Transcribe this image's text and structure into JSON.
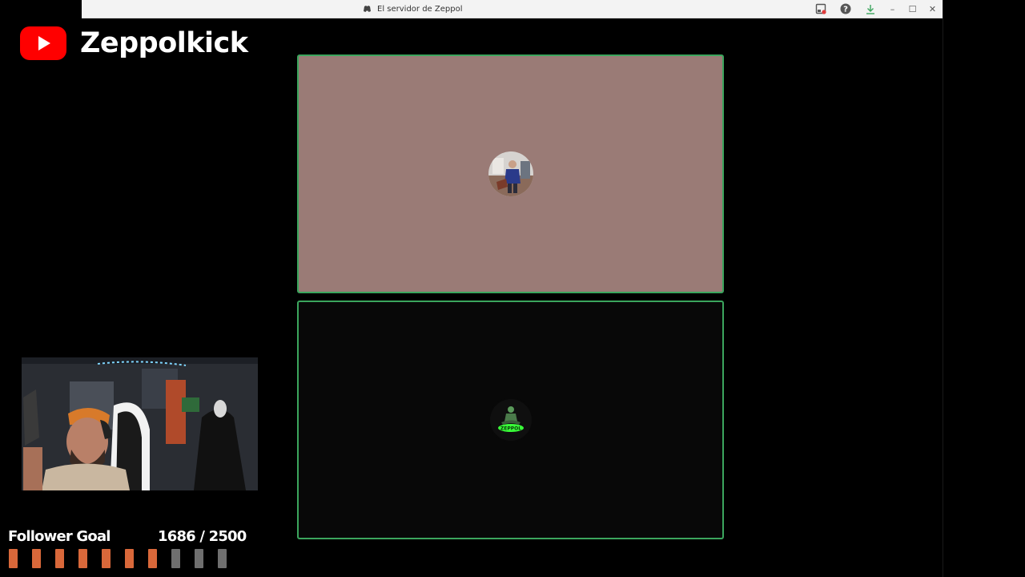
{
  "window": {
    "title": "El servidor de Zeppol",
    "icons": [
      "screen-record-icon",
      "help-icon",
      "download-icon"
    ],
    "controls": {
      "minimize": "–",
      "maximize": "☐",
      "close": "✕"
    }
  },
  "brand": {
    "name": "Zeppolkick",
    "logo_icon": "youtube-play-icon",
    "logo_color": "#ff0000"
  },
  "call": {
    "speaking_border_color": "#3ba55d",
    "tiles": [
      {
        "background": "#9a7b76",
        "avatar_icon": "user-photo-avatar"
      },
      {
        "background": "#080808",
        "avatar_icon": "zeppol-logo-avatar"
      }
    ]
  },
  "follower_goal": {
    "label": "Follower Goal",
    "current": 1686,
    "target": 2500,
    "count_text": "1686 / 2500",
    "filled_color": "#d9683a",
    "empty_color": "#6f6f6f"
  }
}
